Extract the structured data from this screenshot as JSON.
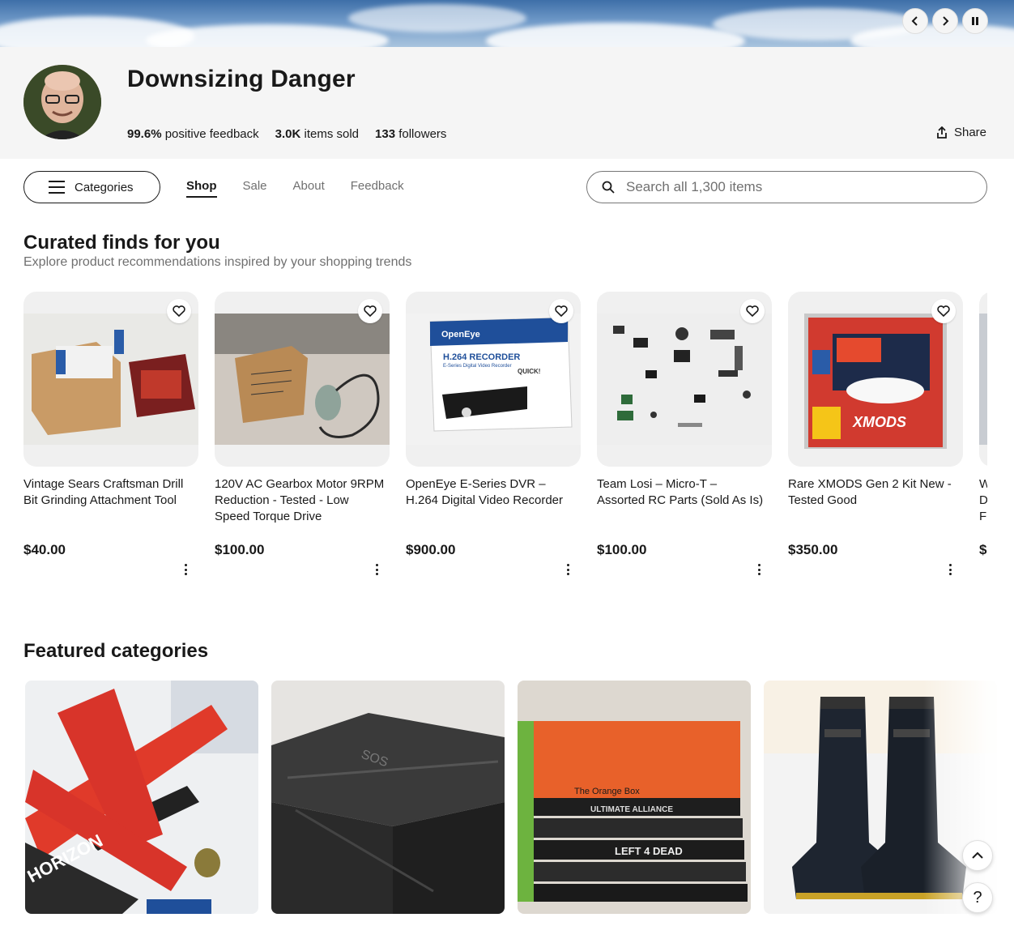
{
  "store": {
    "name": "Downsizing Danger",
    "feedback_value": "99.6%",
    "feedback_label": "positive feedback",
    "sold_value": "3.0K",
    "sold_label": "items sold",
    "followers_value": "133",
    "followers_label": "followers",
    "share_label": "Share"
  },
  "nav": {
    "categories_label": "Categories",
    "tabs": [
      "Shop",
      "Sale",
      "About",
      "Feedback"
    ],
    "active_tab": "Shop"
  },
  "search": {
    "placeholder": "Search all 1,300 items"
  },
  "curated": {
    "title": "Curated finds for you",
    "subtitle": "Explore product recommendations inspired by your shopping trends",
    "items": [
      {
        "title": "Vintage Sears Craftsman Drill Bit Grinding Attachment Tool",
        "price": "$40.00"
      },
      {
        "title": "120V AC Gearbox Motor 9RPM Reduction - Tested - Low Speed Torque Drive",
        "price": "$100.00"
      },
      {
        "title": "OpenEye E-Series DVR – H.264 Digital Video Recorder",
        "price": "$900.00"
      },
      {
        "title": "Team Losi – Micro-T – Assorted RC Parts (Sold As Is)",
        "price": "$100.00"
      },
      {
        "title": "Rare XMODS Gen 2 Kit New - Tested Good",
        "price": "$350.00"
      },
      {
        "title": "W D F",
        "price": "$"
      }
    ]
  },
  "featured": {
    "title": "Featured categories"
  },
  "product_image_text": {
    "openeye_brand": "OpenEye",
    "openeye_model": "H.264 RECORDER",
    "openeye_sub": "E-Series Digital Video Recorder",
    "openeye_quick": "QUICK!",
    "xmods_logo": "XMODS",
    "plane_brand": "HORIZON",
    "game_title": "The Orange Box",
    "game_2": "ULTIMATE ALLIANCE",
    "game_3": "LEFT 4 DEAD"
  },
  "icons": {
    "banner_prev": "chevron-left-icon",
    "banner_next": "chevron-right-icon",
    "banner_pause": "pause-icon",
    "share": "share-icon",
    "menu": "hamburger-icon",
    "search": "search-icon",
    "fav": "heart-icon",
    "more": "more-vertical-icon",
    "scroll_top": "chevron-up-icon",
    "help": "help-icon"
  },
  "colors": {
    "header_bg": "#f5f5f5",
    "text": "#191919",
    "muted": "#707070"
  }
}
